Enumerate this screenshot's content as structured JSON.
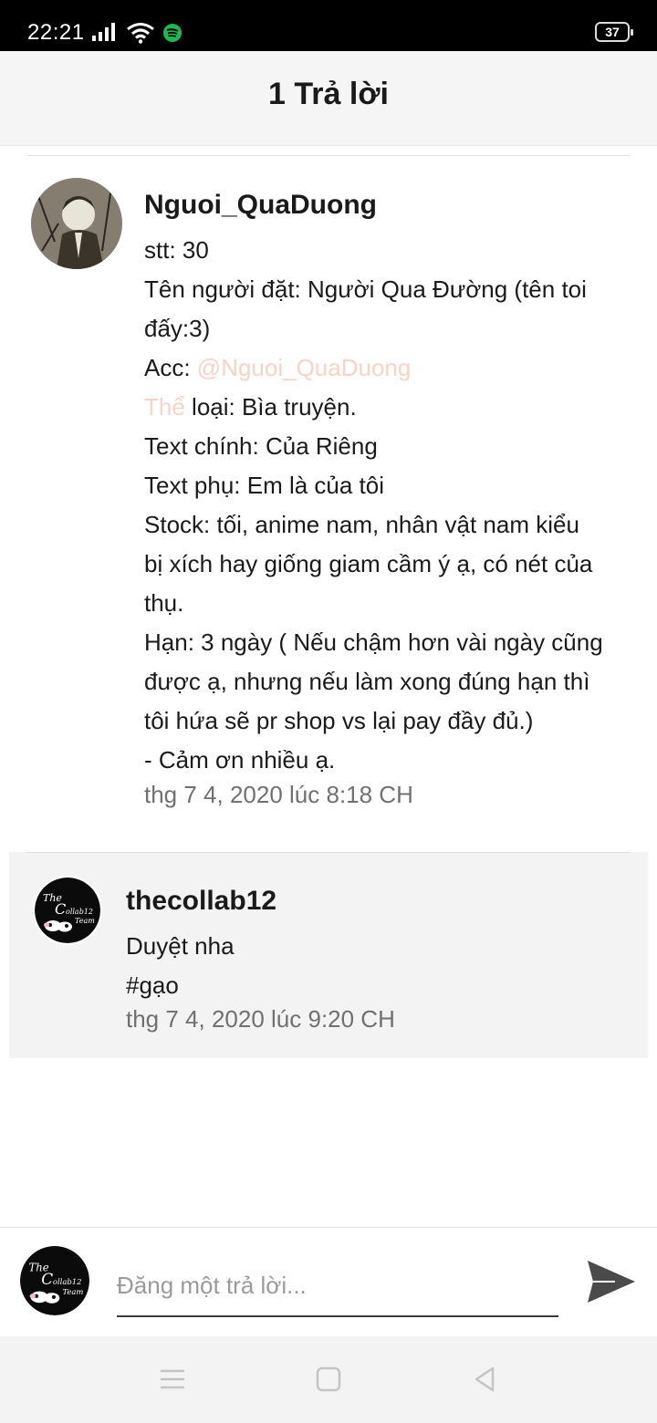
{
  "status_bar": {
    "time": "22:21",
    "battery": "37"
  },
  "header": {
    "title": "1 Trả lời"
  },
  "post": {
    "username": "Nguoi_QuaDuong",
    "lines": [
      {
        "text": "stt: 30"
      },
      {
        "text": "Tên người đặt: Người Qua Đường (tên toi"
      },
      {
        "text": "đấy:3)"
      },
      {
        "prefix": "Acc: ",
        "mention": "@Nguoi_QuaDuong"
      },
      {
        "mention": "Thể",
        "suffix": " loại: Bìa truyện."
      },
      {
        "text": "Text chính: Của Riêng"
      },
      {
        "text": "Text phụ: Em là của tôi"
      },
      {
        "text": "Stock: tối, anime nam, nhân vật nam kiểu"
      },
      {
        "text": "bị xích hay giống giam cầm ý ạ, có nét của"
      },
      {
        "text": "thụ."
      },
      {
        "text": "Hạn: 3 ngày ( Nếu chậm hơn vài ngày cũng"
      },
      {
        "text": "được ạ, nhưng nếu làm xong đúng hạn thì"
      },
      {
        "text": "tôi hứa sẽ pr shop vs lại pay đầy đủ.)"
      },
      {
        "text": "- Cảm ơn nhiều ạ."
      }
    ],
    "timestamp": "thg 7 4, 2020 lúc 8:18 CH"
  },
  "reply": {
    "username": "thecollab12",
    "lines": [
      "Duyệt nha",
      "#gạo"
    ],
    "timestamp": "thg 7 4, 2020 lúc 9:20 CH"
  },
  "composer": {
    "placeholder": "Đăng một trả lời..."
  },
  "colors": {
    "mention": "#f7d3c6",
    "timestamp": "#707070",
    "spotify": "#1db954"
  },
  "icons": {
    "signal": "signal-icon",
    "wifi": "wifi-icon",
    "spotify": "spotify-icon",
    "send": "send-icon",
    "menu": "menu-icon",
    "home": "home-icon",
    "back": "back-icon"
  }
}
